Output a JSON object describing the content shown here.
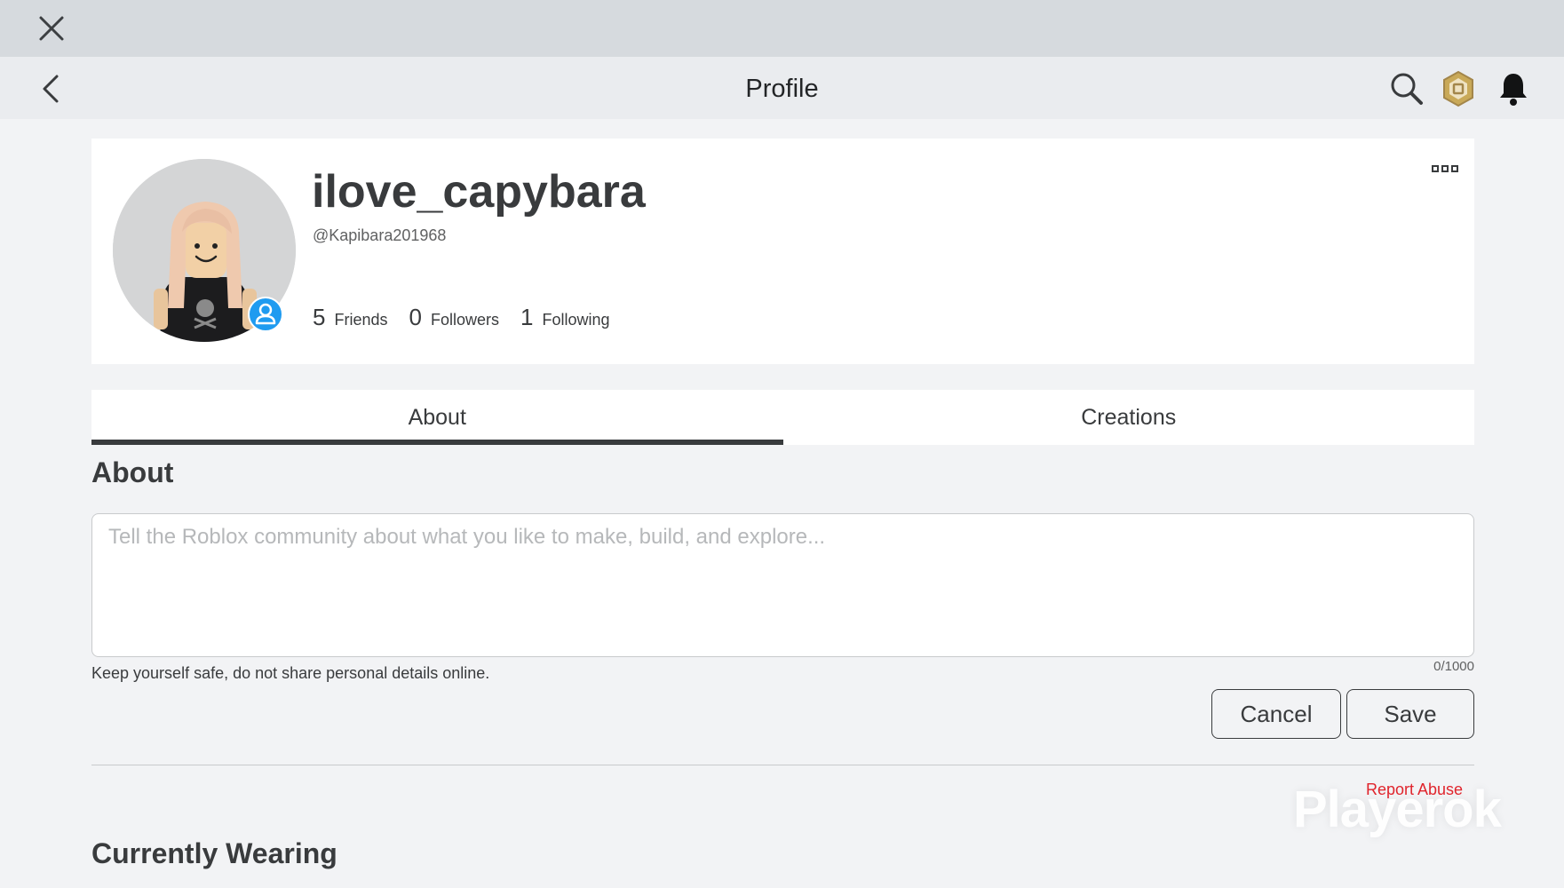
{
  "header": {
    "title": "Profile"
  },
  "profile": {
    "display_name": "ilove_capybara",
    "username": "@Kapibara201968",
    "stats": [
      {
        "count": "5",
        "label": "Friends"
      },
      {
        "count": "0",
        "label": "Followers"
      },
      {
        "count": "1",
        "label": "Following"
      }
    ]
  },
  "tabs": [
    {
      "label": "About",
      "active": true
    },
    {
      "label": "Creations",
      "active": false
    }
  ],
  "about": {
    "title": "About",
    "placeholder": "Tell the Roblox community about what you like to make, build, and explore...",
    "value": "",
    "counter": "0/1000",
    "safety_note": "Keep yourself safe, do not share personal details online.",
    "cancel_label": "Cancel",
    "save_label": "Save"
  },
  "report_abuse": "Report Abuse",
  "watermark": "Playerok",
  "currently_wearing": {
    "title": "Currently Wearing"
  },
  "icons": {
    "close": "close-icon",
    "back": "chevron-left-icon",
    "search": "search-icon",
    "robux": "robux-icon",
    "bell": "bell-icon",
    "more": "more-icon",
    "badge": "person-icon"
  },
  "colors": {
    "accent_blue": "#1f9bf0",
    "report_red": "#e0242c",
    "text": "#393b3d"
  }
}
